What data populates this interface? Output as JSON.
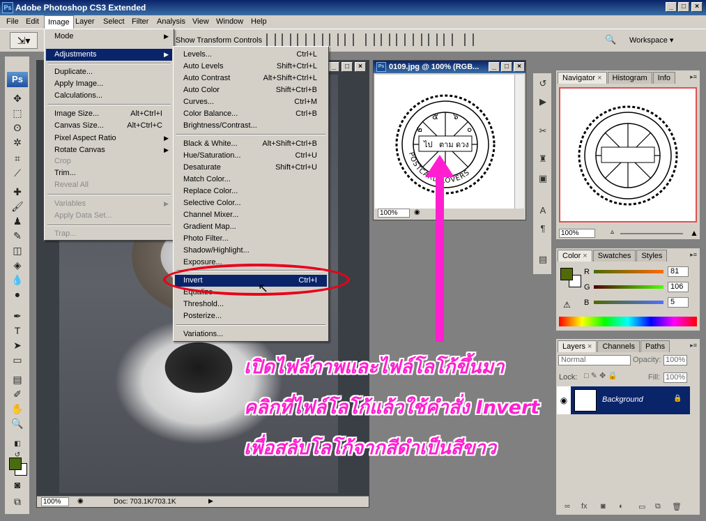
{
  "window": {
    "title": "Adobe Photoshop CS3 Extended",
    "badge": "Ps"
  },
  "menubar": [
    "File",
    "Edit",
    "Image",
    "Layer",
    "Select",
    "Filter",
    "Analysis",
    "View",
    "Window",
    "Help"
  ],
  "options_bar": {
    "label": "Show Transform Controls",
    "workspace": "Workspace"
  },
  "toolbox": {
    "logo": "Ps"
  },
  "image_menu": {
    "items": [
      {
        "label": "Mode",
        "submenu": true
      },
      {
        "label": "Adjustments",
        "submenu": true,
        "highlighted": true
      },
      {
        "label": "Duplicate..."
      },
      {
        "label": "Apply Image..."
      },
      {
        "label": "Calculations..."
      },
      {
        "label": "Image Size...",
        "shortcut": "Alt+Ctrl+I"
      },
      {
        "label": "Canvas Size...",
        "shortcut": "Alt+Ctrl+C"
      },
      {
        "label": "Pixel Aspect Ratio",
        "submenu": true
      },
      {
        "label": "Rotate Canvas",
        "submenu": true
      },
      {
        "label": "Crop",
        "disabled": true
      },
      {
        "label": "Trim..."
      },
      {
        "label": "Reveal All",
        "disabled": true
      },
      {
        "label": "Variables",
        "submenu": true,
        "disabled": true
      },
      {
        "label": "Apply Data Set...",
        "disabled": true
      },
      {
        "label": "Trap...",
        "disabled": true
      }
    ]
  },
  "adjustments_menu": {
    "items": [
      {
        "label": "Levels...",
        "shortcut": "Ctrl+L"
      },
      {
        "label": "Auto Levels",
        "shortcut": "Shift+Ctrl+L"
      },
      {
        "label": "Auto Contrast",
        "shortcut": "Alt+Shift+Ctrl+L"
      },
      {
        "label": "Auto Color",
        "shortcut": "Shift+Ctrl+B"
      },
      {
        "label": "Curves...",
        "shortcut": "Ctrl+M"
      },
      {
        "label": "Color Balance...",
        "shortcut": "Ctrl+B"
      },
      {
        "label": "Brightness/Contrast..."
      },
      {
        "label": "Black & White...",
        "shortcut": "Alt+Shift+Ctrl+B"
      },
      {
        "label": "Hue/Saturation...",
        "shortcut": "Ctrl+U"
      },
      {
        "label": "Desaturate",
        "shortcut": "Shift+Ctrl+U"
      },
      {
        "label": "Match Color..."
      },
      {
        "label": "Replace Color..."
      },
      {
        "label": "Selective Color..."
      },
      {
        "label": "Channel Mixer..."
      },
      {
        "label": "Gradient Map..."
      },
      {
        "label": "Photo Filter..."
      },
      {
        "label": "Shadow/Highlight..."
      },
      {
        "label": "Exposure..."
      },
      {
        "label": "Invert",
        "shortcut": "Ctrl+I",
        "highlighted": true
      },
      {
        "label": "Equalize"
      },
      {
        "label": "Threshold..."
      },
      {
        "label": "Posterize..."
      },
      {
        "label": "Variations..."
      }
    ]
  },
  "dog_doc": {
    "zoom": "100%",
    "doc_size": "Doc: 703.1K/703.1K"
  },
  "logo_doc": {
    "title": "0109.jpg @ 100% (RGB...",
    "zoom": "100%",
    "stamp": {
      "digits": [
        "๕",
        "๖",
        "๒",
        "๐"
      ],
      "words": [
        "ไป",
        "ตาม",
        "ดวง"
      ],
      "ring_text": "POSTCARD LOVERS"
    }
  },
  "navigator": {
    "tabs": [
      "Navigator",
      "Histogram",
      "Info"
    ],
    "zoom": "100%"
  },
  "color_panel": {
    "tabs": [
      "Color",
      "Swatches",
      "Styles"
    ],
    "r_label": "R",
    "g_label": "G",
    "b_label": "B",
    "r": "81",
    "g": "106",
    "b": "5",
    "fg_color": "#516a05"
  },
  "layers_panel": {
    "tabs": [
      "Layers",
      "Channels",
      "Paths"
    ],
    "blend_mode": "Normal",
    "opacity_label": "Opacity:",
    "opacity": "100%",
    "lock_label": "Lock:",
    "fill_label": "Fill:",
    "fill": "100%",
    "layer_name": "Background"
  },
  "annotation": {
    "lines": [
      "เปิดไฟล์ภาพและไฟล์โลโก้ขึ้นมา",
      "คลิกที่ไฟล์โลโก้แล้วใช้คำสั่ง Invert",
      "เพื่อสลับโลโก้จากสีดำเป็นสีขาว"
    ],
    "highlight_color": "#e8001a",
    "text_color": "#ff1fd0"
  }
}
